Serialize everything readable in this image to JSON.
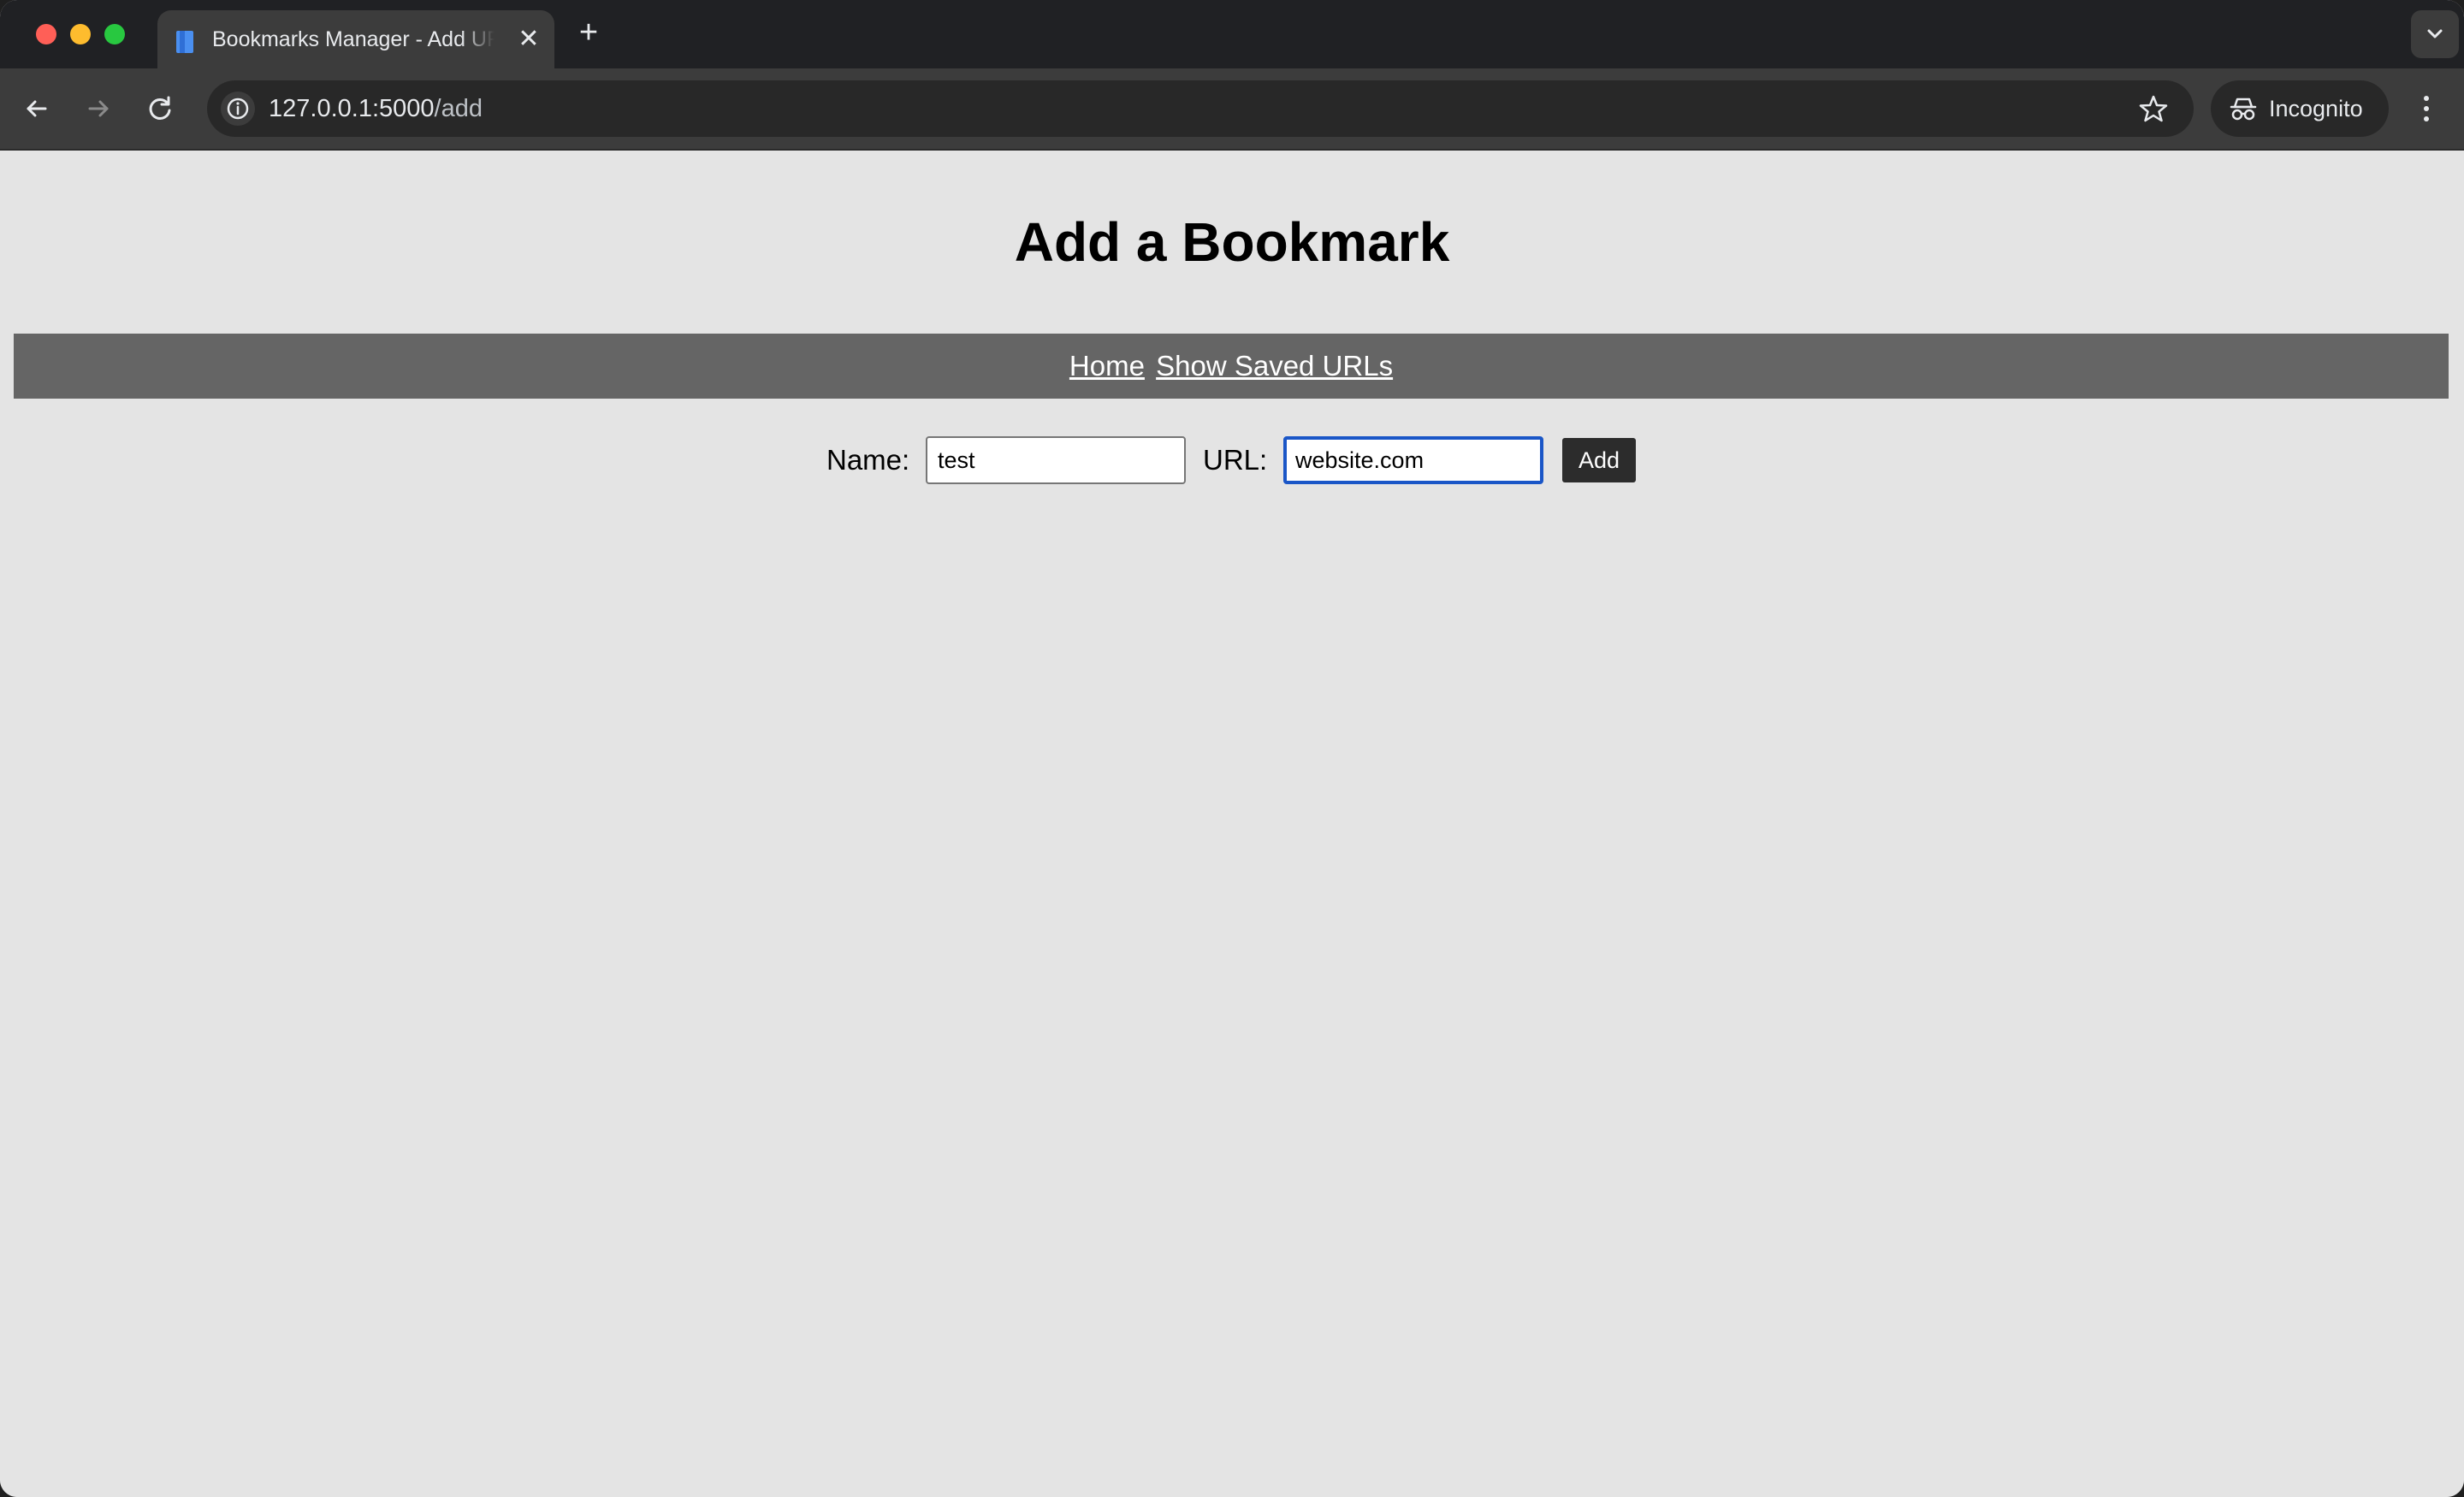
{
  "browser": {
    "tab": {
      "title": "Bookmarks Manager - Add URL",
      "close_glyph": "✕"
    },
    "new_tab_glyph": "+",
    "address": {
      "host": "127.0.0.1:5000",
      "path": "/add"
    },
    "profile_label": "Incognito",
    "icons": {
      "back": "arrow-left-icon",
      "forward": "arrow-right-icon",
      "reload": "reload-icon",
      "site_info": "info-icon",
      "bookmark": "star-icon",
      "incognito": "incognito-icon",
      "menu": "kebab-menu-icon",
      "tab_search": "chevron-down-icon"
    }
  },
  "page": {
    "title": "Add a Bookmark",
    "nav": {
      "home": "Home",
      "saved": "Show Saved URLs"
    },
    "form": {
      "name_label": "Name:",
      "name_value": "test",
      "url_label": "URL:",
      "url_value": "website.com",
      "submit_label": "Add"
    }
  },
  "colors": {
    "page_background": "#e4e4e4",
    "navbar_background": "#656565",
    "button_background": "#2c2c2c",
    "focus_ring": "#1a56c7"
  }
}
